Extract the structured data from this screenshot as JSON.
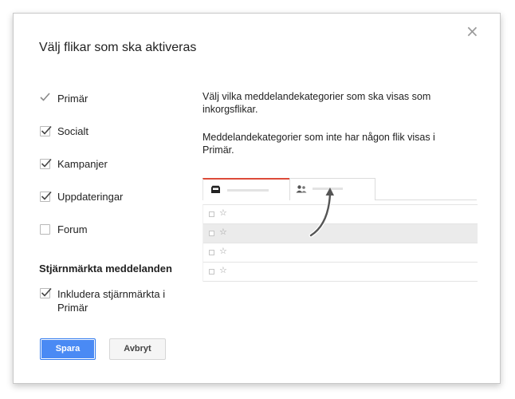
{
  "dialog": {
    "title": "Välj flikar som ska aktiveras",
    "close_icon": "close-icon"
  },
  "tabs": [
    {
      "label": "Primär",
      "checked": true,
      "enabled": false
    },
    {
      "label": "Socialt",
      "checked": true,
      "enabled": true
    },
    {
      "label": "Kampanjer",
      "checked": true,
      "enabled": true
    },
    {
      "label": "Uppdateringar",
      "checked": true,
      "enabled": true
    },
    {
      "label": "Forum",
      "checked": false,
      "enabled": true
    }
  ],
  "starred": {
    "heading": "Stjärnmärkta meddelanden",
    "option_label": "Inkludera stjärnmärkta i Primär",
    "checked": true
  },
  "description": {
    "p1": "Välj vilka meddelandekategorier som ska visas som inkorgsflikar.",
    "p2": "Meddelandekategorier som inte har någon flik visas i Primär."
  },
  "preview": {
    "tab_icons": [
      "inbox-icon",
      "people-icon"
    ],
    "rows": 4,
    "star_glyph": "☆"
  },
  "buttons": {
    "save_label": "Spara",
    "cancel_label": "Avbryt"
  },
  "colors": {
    "accent_blue": "#4a8af4",
    "tab_red": "#dd4b39"
  }
}
